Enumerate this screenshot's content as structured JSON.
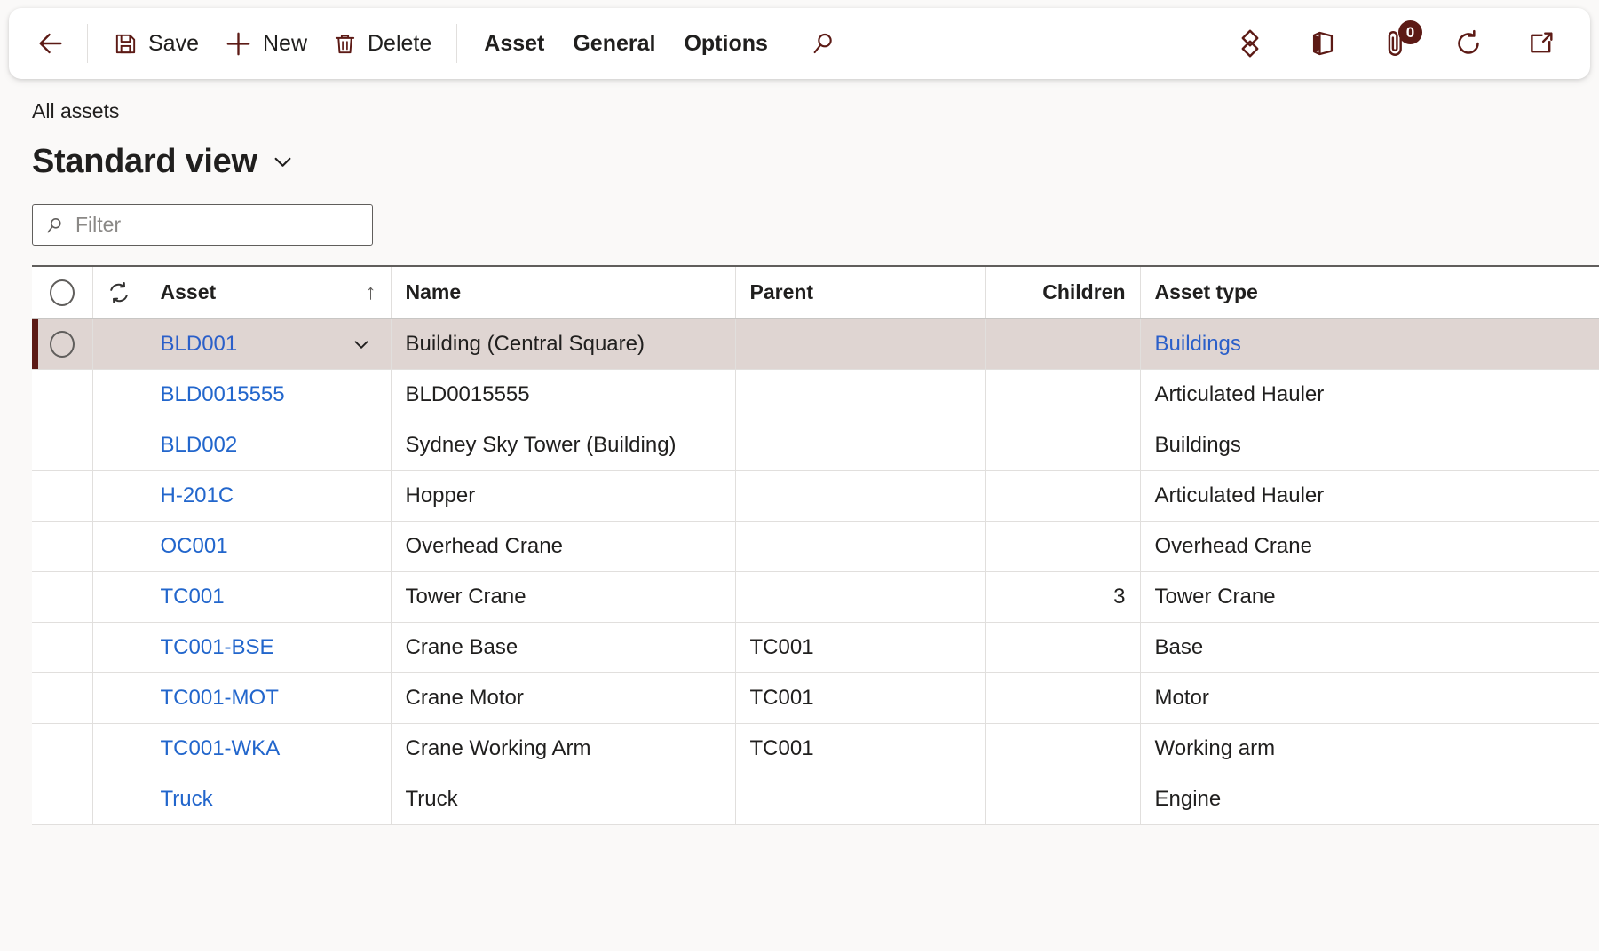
{
  "commandbar": {
    "back": "back-arrow-icon",
    "save_label": "Save",
    "new_label": "New",
    "delete_label": "Delete",
    "menus": [
      "Asset",
      "General",
      "Options"
    ],
    "search_icon": "search-icon",
    "right_icons": [
      {
        "name": "personalize-icon",
        "label": ""
      },
      {
        "name": "office-apps-icon",
        "label": ""
      },
      {
        "name": "attachments-icon",
        "badge": "0"
      },
      {
        "name": "refresh-icon",
        "label": ""
      },
      {
        "name": "open-in-new-window-icon",
        "label": ""
      }
    ]
  },
  "header": {
    "breadcrumb": "All assets",
    "title": "Standard view"
  },
  "filter": {
    "placeholder": "Filter",
    "value": ""
  },
  "grid": {
    "columns": [
      {
        "key": "select",
        "label": ""
      },
      {
        "key": "sync",
        "label": ""
      },
      {
        "key": "asset",
        "label": "Asset",
        "sort": "↑"
      },
      {
        "key": "name",
        "label": "Name"
      },
      {
        "key": "parent",
        "label": "Parent"
      },
      {
        "key": "children",
        "label": "Children",
        "align": "right"
      },
      {
        "key": "asset_type",
        "label": "Asset type"
      }
    ],
    "rows": [
      {
        "asset": "BLD001",
        "name": "Building (Central Square)",
        "parent": "",
        "children": "",
        "asset_type": "Buildings",
        "selected": true,
        "expandable": true,
        "type_is_link": true
      },
      {
        "asset": "BLD0015555",
        "name": "BLD0015555",
        "parent": "",
        "children": "",
        "asset_type": "Articulated Hauler",
        "selected": false,
        "expandable": false,
        "type_is_link": false
      },
      {
        "asset": "BLD002",
        "name": "Sydney Sky Tower (Building)",
        "parent": "",
        "children": "",
        "asset_type": "Buildings",
        "selected": false,
        "expandable": false,
        "type_is_link": false
      },
      {
        "asset": "H-201C",
        "name": "Hopper",
        "parent": "",
        "children": "",
        "asset_type": "Articulated Hauler",
        "selected": false,
        "expandable": false,
        "type_is_link": false
      },
      {
        "asset": "OC001",
        "name": "Overhead Crane",
        "parent": "",
        "children": "",
        "asset_type": "Overhead Crane",
        "selected": false,
        "expandable": false,
        "type_is_link": false
      },
      {
        "asset": "TC001",
        "name": "Tower Crane",
        "parent": "",
        "children": "3",
        "asset_type": "Tower Crane",
        "selected": false,
        "expandable": false,
        "type_is_link": false
      },
      {
        "asset": "TC001-BSE",
        "name": "Crane Base",
        "parent": "TC001",
        "children": "",
        "asset_type": "Base",
        "selected": false,
        "expandable": false,
        "type_is_link": false
      },
      {
        "asset": "TC001-MOT",
        "name": "Crane Motor",
        "parent": "TC001",
        "children": "",
        "asset_type": "Motor",
        "selected": false,
        "expandable": false,
        "type_is_link": false
      },
      {
        "asset": "TC001-WKA",
        "name": "Crane Working Arm",
        "parent": "TC001",
        "children": "",
        "asset_type": "Working arm",
        "selected": false,
        "expandable": false,
        "type_is_link": false
      },
      {
        "asset": "Truck",
        "name": "Truck",
        "parent": "",
        "children": "",
        "asset_type": "Engine",
        "selected": false,
        "expandable": false,
        "type_is_link": false
      }
    ]
  },
  "colors": {
    "accent": "#5C1A15",
    "link": "#2266CC",
    "selected_row": "#DFD5D2",
    "page_bg": "#FAF9F8"
  }
}
